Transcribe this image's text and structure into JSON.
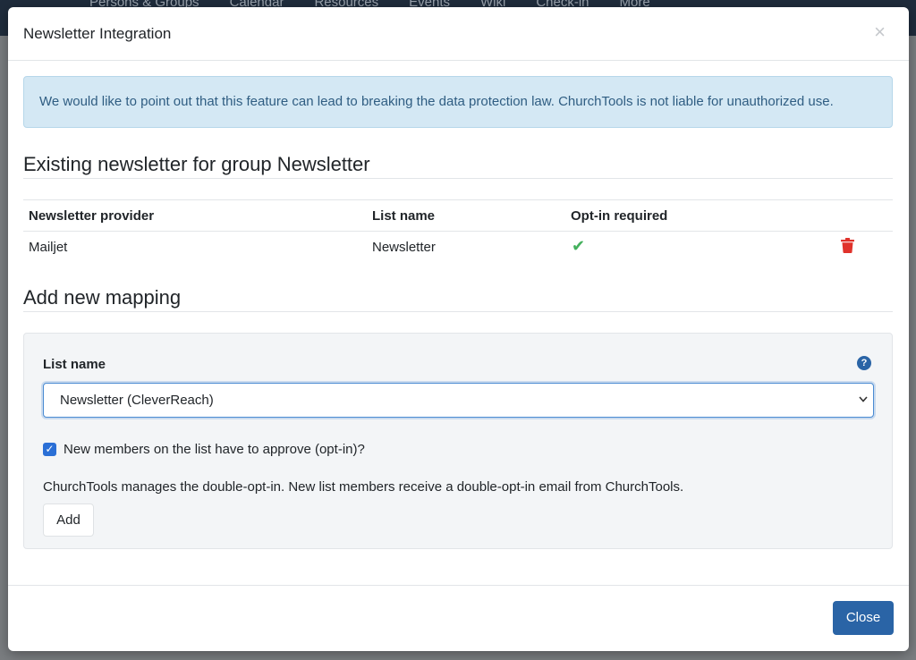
{
  "background": {
    "nav_items": [
      "Persons & Groups",
      "Calendar",
      "Resources",
      "Events",
      "Wiki",
      "Check-in",
      "More"
    ]
  },
  "modal": {
    "title": "Newsletter Integration",
    "close_symbol": "×",
    "alert_text": "We would like to point out that this feature can lead to breaking the data protection law. ChurchTools is not liable for unauthorized use.",
    "existing": {
      "title": "Existing newsletter for group Newsletter",
      "headers": [
        "Newsletter provider",
        "List name",
        "Opt-in required"
      ],
      "rows": [
        {
          "provider": "Mailjet",
          "list_name": "Newsletter",
          "opt_in": "✔"
        }
      ]
    },
    "add": {
      "title": "Add new mapping",
      "list_label": "List name",
      "help_symbol": "?",
      "selected_list": "Newsletter (CleverReach)",
      "chevron": "⌄",
      "opt_in_checked": true,
      "opt_in_label": "New members on the list have to approve (opt-in)?",
      "note": "ChurchTools manages the double-opt-in. New list members receive a double-opt-in email from ChurchTools.",
      "add_label": "Add"
    },
    "close_label": "Close"
  },
  "colors": {
    "primary": "#2a64a6",
    "check": "#43b05c",
    "danger": "#e0322b",
    "alert_bg": "#d4e8f4"
  }
}
